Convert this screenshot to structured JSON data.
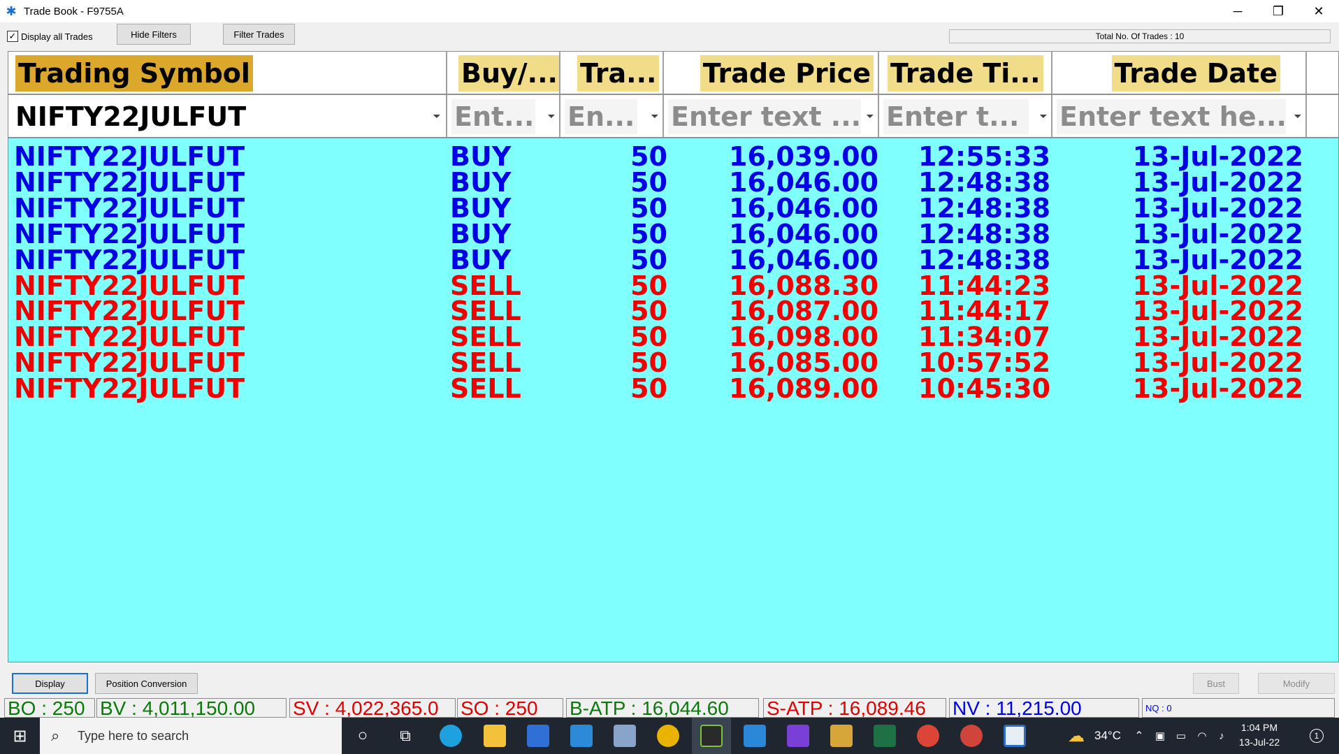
{
  "window": {
    "title": "Trade Book - F9755A",
    "minimize": "─",
    "restore": "❐",
    "close": "✕"
  },
  "toolbar": {
    "display_all_label": "Display all Trades",
    "display_all_checked": "✓",
    "hide_filters": "Hide Filters",
    "filter_trades": "Filter Trades",
    "total_trades": "Total No. Of Trades : 10"
  },
  "grid": {
    "columns": [
      "Trading Symbol",
      "Buy/...",
      "Tra...",
      "Trade Price",
      "Trade Ti...",
      "Trade Date"
    ],
    "filters": [
      "NIFTY22JULFUT",
      "Ent...",
      "En...",
      "Enter text ...",
      "Enter t...",
      "Enter text he..."
    ],
    "rows": [
      {
        "symbol": "NIFTY22JULFUT",
        "side": "BUY",
        "qty": "50",
        "price": "16,039.00",
        "time": "12:55:33",
        "date": "13-Jul-2022"
      },
      {
        "symbol": "NIFTY22JULFUT",
        "side": "BUY",
        "qty": "50",
        "price": "16,046.00",
        "time": "12:48:38",
        "date": "13-Jul-2022"
      },
      {
        "symbol": "NIFTY22JULFUT",
        "side": "BUY",
        "qty": "50",
        "price": "16,046.00",
        "time": "12:48:38",
        "date": "13-Jul-2022"
      },
      {
        "symbol": "NIFTY22JULFUT",
        "side": "BUY",
        "qty": "50",
        "price": "16,046.00",
        "time": "12:48:38",
        "date": "13-Jul-2022"
      },
      {
        "symbol": "NIFTY22JULFUT",
        "side": "BUY",
        "qty": "50",
        "price": "16,046.00",
        "time": "12:48:38",
        "date": "13-Jul-2022"
      },
      {
        "symbol": "NIFTY22JULFUT",
        "side": "SELL",
        "qty": "50",
        "price": "16,088.30",
        "time": "11:44:23",
        "date": "13-Jul-2022"
      },
      {
        "symbol": "NIFTY22JULFUT",
        "side": "SELL",
        "qty": "50",
        "price": "16,087.00",
        "time": "11:44:17",
        "date": "13-Jul-2022"
      },
      {
        "symbol": "NIFTY22JULFUT",
        "side": "SELL",
        "qty": "50",
        "price": "16,098.00",
        "time": "11:34:07",
        "date": "13-Jul-2022"
      },
      {
        "symbol": "NIFTY22JULFUT",
        "side": "SELL",
        "qty": "50",
        "price": "16,085.00",
        "time": "10:57:52",
        "date": "13-Jul-2022"
      },
      {
        "symbol": "NIFTY22JULFUT",
        "side": "SELL",
        "qty": "50",
        "price": "16,089.00",
        "time": "10:45:30",
        "date": "13-Jul-2022"
      }
    ]
  },
  "bottom": {
    "display": "Display",
    "position_conversion": "Position Conversion",
    "bust": "Bust",
    "modify": "Modify"
  },
  "status": {
    "bo": "BO : 250",
    "bv": "BV : 4,011,150.00",
    "sv": "SV : 4,022,365.0",
    "so": "SO : 250",
    "batp": "B-ATP : 16,044.60",
    "satp": "S-ATP : 16,089.46",
    "nv": "NV : 11,215.00",
    "nq": "NQ : 0"
  },
  "taskbar": {
    "search_placeholder": "Type here to search",
    "temperature": "34°C",
    "time": "1:04 PM",
    "date": "13-Jul-22",
    "notification_count": "1"
  },
  "colors": {
    "grid_bg": "#80ffff",
    "buy": "#0000e6",
    "sell": "#f20000",
    "header_first": "#dba82b",
    "header": "#f1dc8a",
    "status_green": "#0a7a0a",
    "status_red": "#e00000",
    "status_blue": "#0000e6"
  }
}
